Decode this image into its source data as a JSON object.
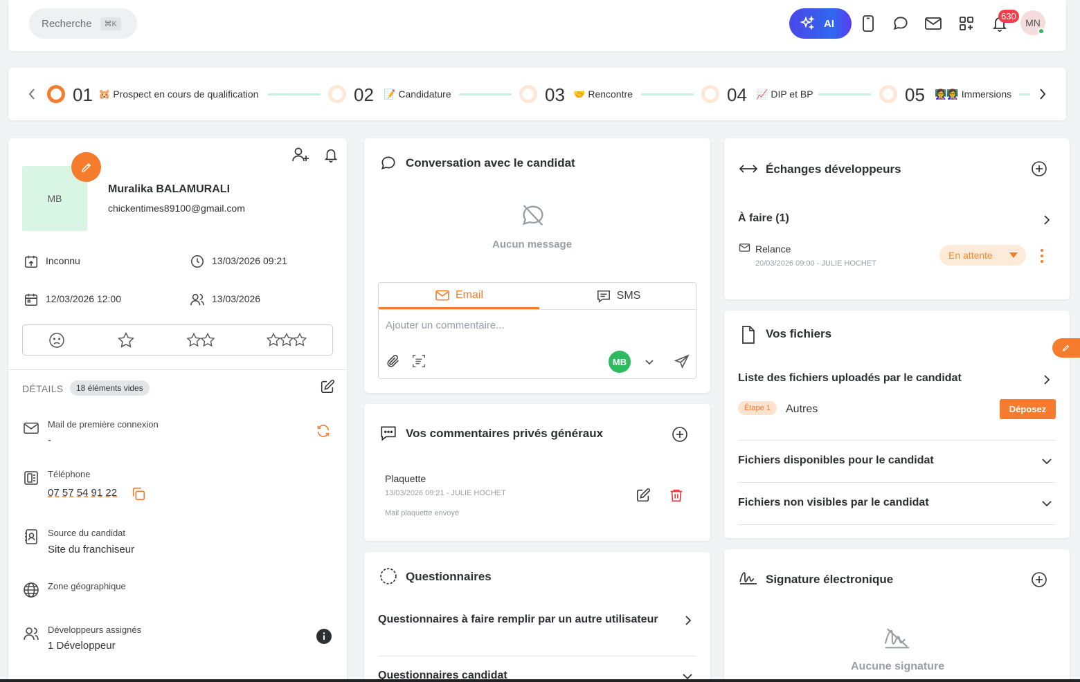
{
  "topbar": {
    "search_label": "Recherche",
    "search_shortcut": "⌘K",
    "ai_label": "AI",
    "notification_count": "630",
    "user_initials": "MN"
  },
  "stepper": {
    "steps": [
      {
        "number": "01",
        "emoji": "🐹",
        "label": "Prospect en cours de qualification",
        "active": true
      },
      {
        "number": "02",
        "emoji": "📝",
        "label": "Candidature",
        "active": false
      },
      {
        "number": "03",
        "emoji": "🤝",
        "label": "Rencontre",
        "active": false
      },
      {
        "number": "04",
        "emoji": "📈",
        "label": "DIP et BP",
        "active": false
      },
      {
        "number": "05",
        "emoji": "👩‍🏫👩‍🏫",
        "label": "Immersions",
        "active": false
      }
    ]
  },
  "candidate": {
    "initials": "MB",
    "name": "Muralika BALAMURALI",
    "email": "chickentimes89100@gmail.com",
    "status": "Inconnu",
    "last_activity": "13/03/2026 09:21",
    "created": "12/03/2026 12:00",
    "meeting": "13/03/2026"
  },
  "details": {
    "title": "DÉTAILS",
    "empty_badge": "18 éléments vides",
    "fields": [
      {
        "label": "Mail de première connexion",
        "value": "-"
      },
      {
        "label": "Téléphone",
        "value": "07 57 54 91 22"
      },
      {
        "label": "Source du candidat",
        "value": "Site du franchiseur"
      },
      {
        "label": "Zone géographique",
        "value": ""
      },
      {
        "label": "Développeurs assignés",
        "value": "1 Développeur"
      }
    ]
  },
  "conversation": {
    "title": "Conversation avec le candidat",
    "empty_text": "Aucun message",
    "tab_email": "Email",
    "tab_sms": "SMS",
    "comment_placeholder": "Ajouter un commentaire...",
    "sender_initials": "MB"
  },
  "comments": {
    "title": "Vos commentaires privés généraux",
    "items": [
      {
        "title": "Plaquette",
        "meta": "13/03/2026 09:21 - JULIE HOCHET",
        "body": "Mail plaquette envoyé"
      }
    ]
  },
  "questionnaires": {
    "title": "Questionnaires",
    "row1": "Questionnaires à faire remplir par un autre utilisateur",
    "row2": "Questionnaires candidat"
  },
  "dev_exchanges": {
    "title": "Échanges développeurs",
    "todo_label": "À faire (1)",
    "task_title": "Relance",
    "task_meta": "20/03/2026 09:00 - JULIE HOCHET",
    "status": "En attente"
  },
  "files": {
    "title": "Vos fichiers",
    "uploaded_label": "Liste des fichiers uploadés par le candidat",
    "step_tag": "Étape 1",
    "item_label": "Autres",
    "drop_button": "Déposez",
    "available_label": "Fichiers disponibles pour le candidat",
    "hidden_label": "Fichiers non visibles par le candidat"
  },
  "signature": {
    "title": "Signature électronique",
    "empty_text": "Aucune signature"
  },
  "colors": {
    "accent": "#f57c2c",
    "success": "#2dbb5e",
    "danger": "#ef3f49",
    "ai_gradient_start": "#4b47e8"
  }
}
